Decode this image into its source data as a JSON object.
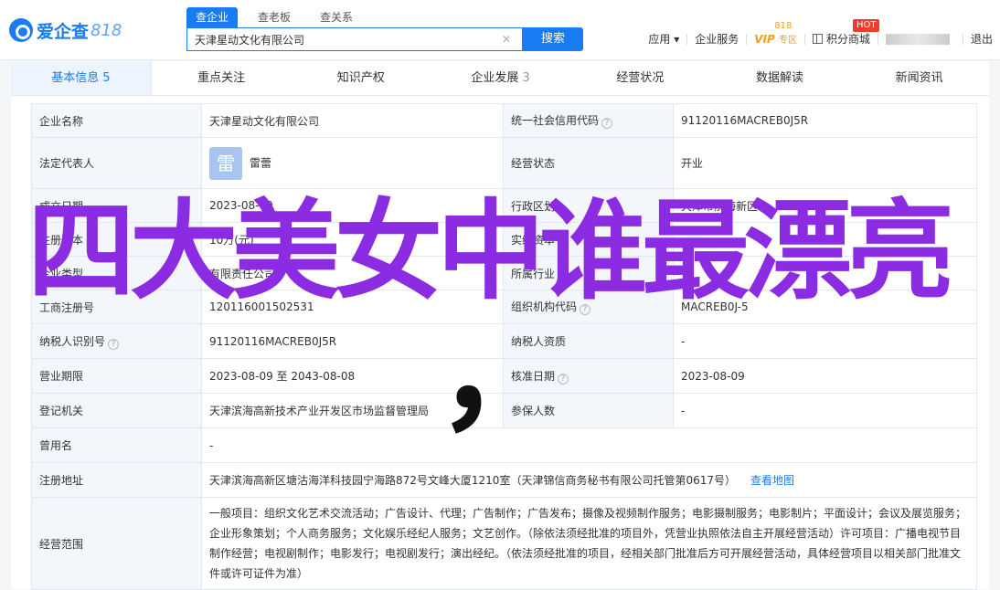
{
  "header": {
    "logo_text": "爱企查",
    "logo_num": "818",
    "search_tabs": [
      "查企业",
      "查老板",
      "查关系"
    ],
    "search_value": "天津星动文化有限公司",
    "search_button": "搜索",
    "nav": {
      "app": "应用",
      "enterprise_service": "企业服务",
      "vip": "VIP",
      "vip_sub": "专区",
      "vip_tag": "818",
      "points_mall": "积分商城",
      "hot": "HOT",
      "logout": "退出"
    }
  },
  "tabs": [
    {
      "label": "基本信息",
      "count": "5"
    },
    {
      "label": "重点关注",
      "count": ""
    },
    {
      "label": "知识产权",
      "count": ""
    },
    {
      "label": "企业发展",
      "count": "3"
    },
    {
      "label": "经营状况",
      "count": ""
    },
    {
      "label": "数据解读",
      "count": ""
    },
    {
      "label": "新闻资讯",
      "count": ""
    }
  ],
  "info": {
    "r1": {
      "k1": "企业名称",
      "v1": "天津星动文化有限公司",
      "k2": "统一社会信用代码",
      "v2": "91120116MACREB0J5R"
    },
    "r2": {
      "k1": "法定代表人",
      "avatar": "雷",
      "v1": "雷蕾",
      "k2": "经营状态",
      "v2": "开业"
    },
    "r3": {
      "k1": "成立日期",
      "v1": "2023-08-09",
      "k2": "行政区划",
      "v2": "天津市滨海新区"
    },
    "r4": {
      "k1": "注册资本",
      "v1": "10万(元)",
      "k2": "实缴资本",
      "v2": "-"
    },
    "r5": {
      "k1": "企业类型",
      "v1": "有限责任公司",
      "k2": "所属行业",
      "v2": "-"
    },
    "r6": {
      "k1": "工商注册号",
      "v1": "120116001502531",
      "k2": "组织机构代码",
      "v2": "MACREB0J-5"
    },
    "r7": {
      "k1": "纳税人识别号",
      "v1": "91120116MACREB0J5R",
      "k2": "纳税人资质",
      "v2": "-"
    },
    "r8": {
      "k1": "营业期限",
      "v1": "2023-08-09 至 2043-08-08",
      "k2": "核准日期",
      "v2": "2023-08-09"
    },
    "r9": {
      "k1": "登记机关",
      "v1": "天津滨海高新技术产业开发区市场监督管理局",
      "k2": "参保人数",
      "v2": "-"
    },
    "r10": {
      "k1": "曾用名",
      "v1": "-"
    },
    "r11": {
      "k1": "注册地址",
      "v1": "天津滨海高新区塘沽海洋科技园宁海路872号文峰大厦1210室（天津锦信商务秘书有限公司托管第0617号）",
      "link": "查看地图"
    },
    "r12": {
      "k1": "经营范围",
      "v1": "一般项目：组织文化艺术交流活动；广告设计、代理；广告制作；广告发布；摄像及视频制作服务；电影摄制服务；电影制片；平面设计；会议及展览服务；企业形象策划；个人商务服务；文化娱乐经纪人服务；文艺创作。（除依法须经批准的项目外，凭营业执照依法自主开展经营活动）许可项目：广播电视节目制作经营；电视剧制作；电影发行；电视剧发行；演出经纪。（依法须经批准的项目，经相关部门批准后方可开展经营活动，具体经营项目以相关部门批准文件或许可证件为准）"
    }
  },
  "overlay": {
    "text": "四大美女中谁最漂亮",
    "comma": "，"
  }
}
